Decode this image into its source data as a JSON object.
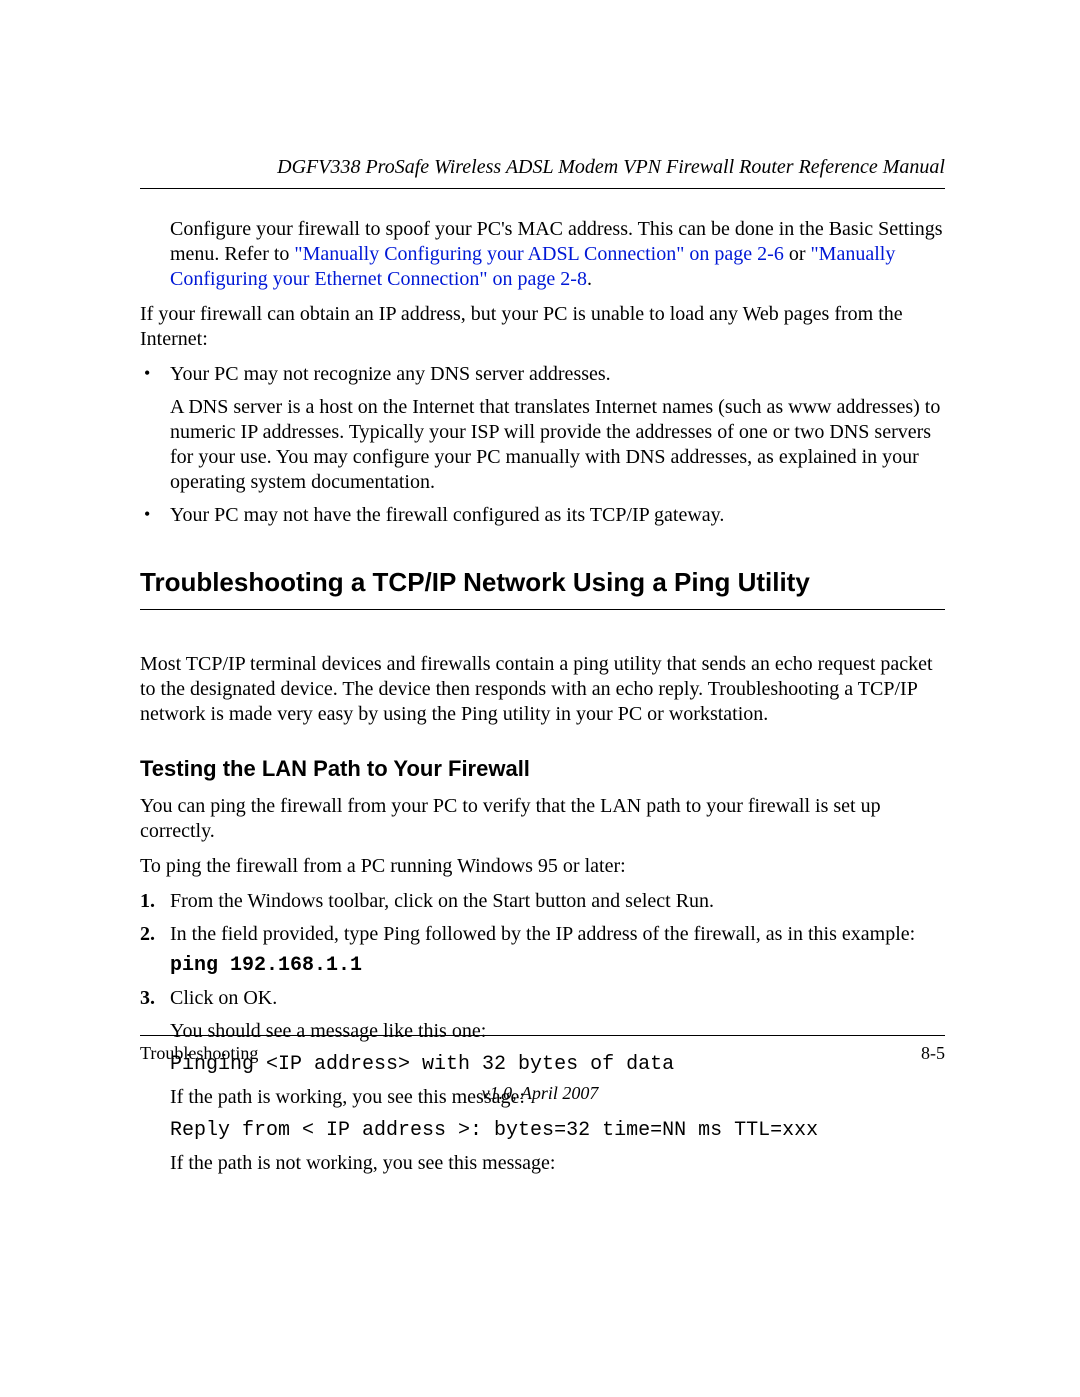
{
  "header": {
    "running_title": "DGFV338 ProSafe Wireless ADSL Modem VPN Firewall Router Reference Manual"
  },
  "intro": {
    "text_before_link1": "Configure your firewall to spoof your PC's MAC address. This can be done in the Basic Settings menu. Refer to ",
    "link1": "\"Manually Configuring your ADSL Connection\" on page 2-6",
    "between": " or ",
    "link2": "\"Manually Configuring your Ethernet Connection\" on page 2-8",
    "after": "."
  },
  "para_ip": "If your firewall can obtain an IP address, but your PC is unable to load any Web pages from the Internet:",
  "bullets": [
    {
      "lead": "Your PC may not recognize any DNS server addresses.",
      "detail": "A DNS server is a host on the Internet that translates Internet names (such as www addresses) to numeric IP addresses. Typically your ISP will provide the addresses of one or two DNS servers for your use. You may configure your PC manually with DNS addresses, as explained in your operating system documentation."
    },
    {
      "lead": "Your PC may not have the firewall configured as its TCP/IP gateway.",
      "detail": ""
    }
  ],
  "section": {
    "title": "Troubleshooting a TCP/IP Network Using a Ping Utility",
    "intro": "Most TCP/IP terminal devices and firewalls contain a ping utility that sends an echo request packet to the designated device. The device then responds with an echo reply. Troubleshooting a TCP/IP network is made very easy by using the Ping utility in your PC or workstation."
  },
  "subsection": {
    "title": "Testing the LAN Path to Your Firewall",
    "p1": "You can ping the firewall from your PC to verify that the LAN path to your firewall is set up correctly.",
    "p2": "To ping the firewall from a PC running Windows 95 or later:",
    "steps": {
      "s1": "From the Windows toolbar, click on the Start button and select Run.",
      "s2": "In the field provided, type Ping followed by the IP address of the firewall, as in this example:",
      "s2_code": "ping 192.168.1.1",
      "s3": "Click on OK.",
      "s3_p1": "You should see a message like this one:",
      "s3_code1": "Pinging <IP address> with 32 bytes of data",
      "s3_p2": "If the path is working, you see this message:",
      "s3_code2": "Reply from < IP address >: bytes=32 time=NN ms TTL=xxx",
      "s3_p3": "If the path is not working, you see this message:"
    }
  },
  "footer": {
    "left": "Troubleshooting",
    "right": "8-5",
    "version": "v1.0, April 2007"
  }
}
